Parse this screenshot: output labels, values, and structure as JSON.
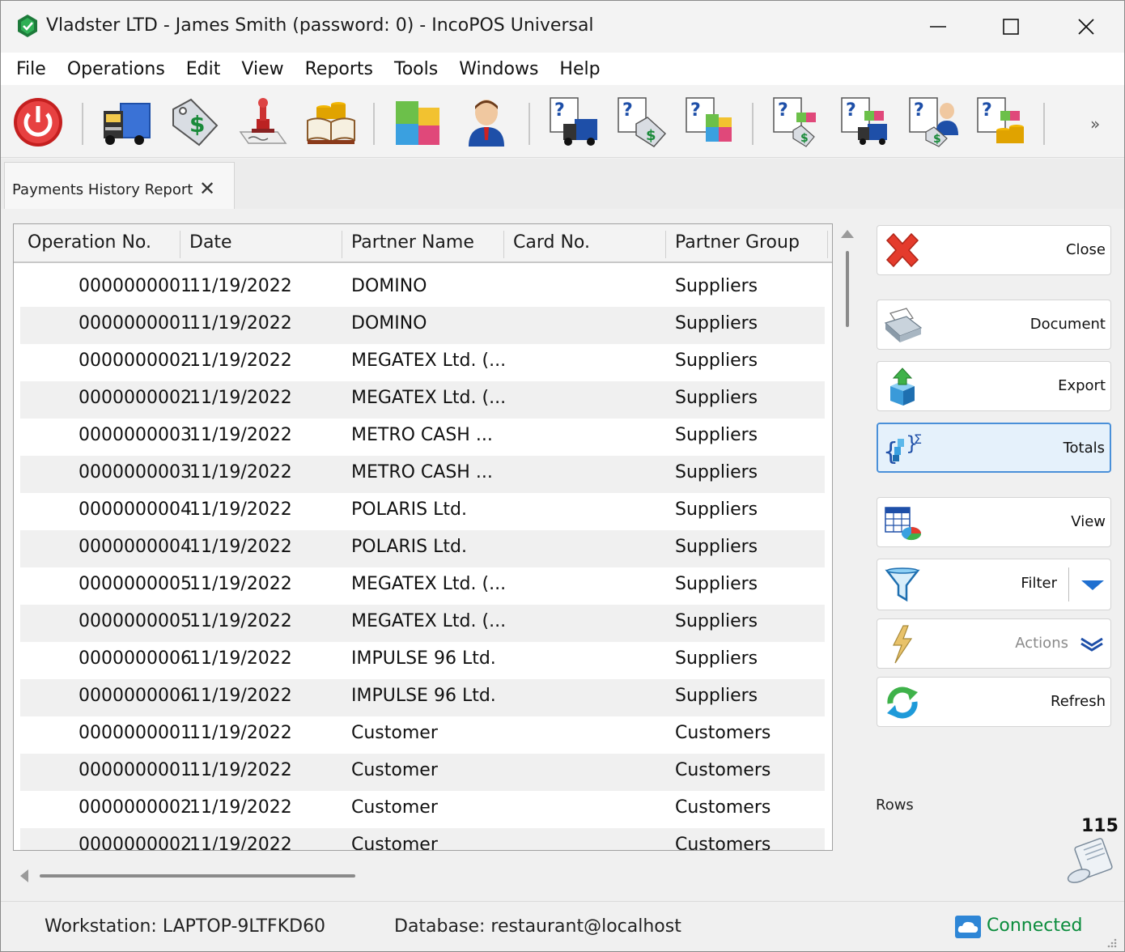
{
  "window": {
    "title": "Vladster LTD - James Smith (password: 0) - IncoPOS Universal"
  },
  "menu": [
    "File",
    "Operations",
    "Edit",
    "View",
    "Reports",
    "Tools",
    "Windows",
    "Help"
  ],
  "toolbar": {
    "more": "»"
  },
  "tab": {
    "label": "Payments History Report",
    "close": "✕"
  },
  "grid": {
    "columns": [
      "Operation No.",
      "Date",
      "Partner Name",
      "Card No.",
      "Partner Group"
    ],
    "rows": [
      [
        "0000000001",
        "11/19/2022",
        "DOMINO",
        "",
        "Suppliers"
      ],
      [
        "0000000001",
        "11/19/2022",
        "DOMINO",
        "",
        "Suppliers"
      ],
      [
        "0000000002",
        "11/19/2022",
        "MEGATEX Ltd. (...",
        "",
        "Suppliers"
      ],
      [
        "0000000002",
        "11/19/2022",
        "MEGATEX Ltd. (...",
        "",
        "Suppliers"
      ],
      [
        "0000000003",
        "11/19/2022",
        "METRO CASH ...",
        "",
        "Suppliers"
      ],
      [
        "0000000003",
        "11/19/2022",
        "METRO CASH ...",
        "",
        "Suppliers"
      ],
      [
        "0000000004",
        "11/19/2022",
        "POLARIS Ltd.",
        "",
        "Suppliers"
      ],
      [
        "0000000004",
        "11/19/2022",
        "POLARIS Ltd.",
        "",
        "Suppliers"
      ],
      [
        "0000000005",
        "11/19/2022",
        "MEGATEX Ltd. (...",
        "",
        "Suppliers"
      ],
      [
        "0000000005",
        "11/19/2022",
        "MEGATEX Ltd. (...",
        "",
        "Suppliers"
      ],
      [
        "0000000006",
        "11/19/2022",
        "IMPULSE 96 Ltd.",
        "",
        "Suppliers"
      ],
      [
        "0000000006",
        "11/19/2022",
        "IMPULSE 96 Ltd.",
        "",
        "Suppliers"
      ],
      [
        "0000000001",
        "11/19/2022",
        "Customer",
        "",
        "Customers"
      ],
      [
        "0000000001",
        "11/19/2022",
        "Customer",
        "",
        "Customers"
      ],
      [
        "0000000002",
        "11/19/2022",
        "Customer",
        "",
        "Customers"
      ],
      [
        "0000000002",
        "11/19/2022",
        "Customer",
        "",
        "Customers"
      ]
    ]
  },
  "side": {
    "close": "Close",
    "document": "Document",
    "export": "Export",
    "totals": "Totals",
    "view": "View",
    "filter": "Filter",
    "actions": "Actions",
    "refresh": "Refresh",
    "rows_label": "Rows",
    "rows_count": "115"
  },
  "status": {
    "workstation": "Workstation: LAPTOP-9LTFKD60",
    "database": "Database: restaurant@localhost",
    "connection": "Connected"
  },
  "colors": {
    "accent": "#4a90d9",
    "connected": "#0a8c3c",
    "close_red": "#e43b2c"
  }
}
